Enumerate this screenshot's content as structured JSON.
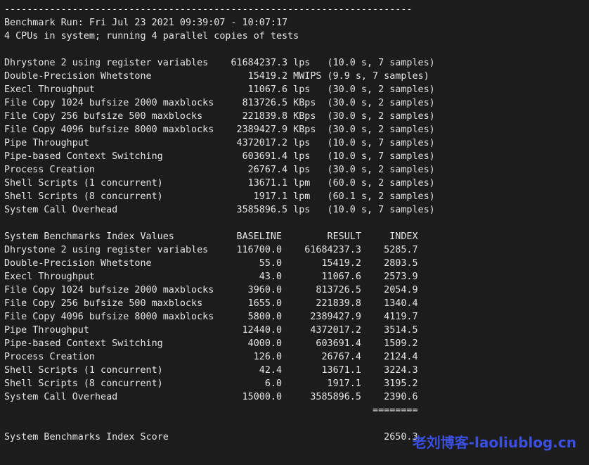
{
  "terminal": {
    "background_color": "#1c1c1c",
    "foreground_color": "#e4e4e4",
    "columns": 84,
    "rule": "------------------------------------------------------------------------",
    "header": {
      "run_line": "Benchmark Run: Fri Jul 23 2021 09:39:07 - 10:07:17",
      "cpu_line": "4 CPUs in system; running 4 parallel copies of tests"
    },
    "raw_results": {
      "rows": [
        {
          "name": "Dhrystone 2 using register variables",
          "value": "61684237.3",
          "unit": "lps",
          "timing": "(10.0 s, 7 samples)"
        },
        {
          "name": "Double-Precision Whetstone",
          "value": "15419.2",
          "unit": "MWIPS",
          "timing": "(9.9 s, 7 samples)"
        },
        {
          "name": "Execl Throughput",
          "value": "11067.6",
          "unit": "lps",
          "timing": "(30.0 s, 2 samples)"
        },
        {
          "name": "File Copy 1024 bufsize 2000 maxblocks",
          "value": "813726.5",
          "unit": "KBps",
          "timing": "(30.0 s, 2 samples)"
        },
        {
          "name": "File Copy 256 bufsize 500 maxblocks",
          "value": "221839.8",
          "unit": "KBps",
          "timing": "(30.0 s, 2 samples)"
        },
        {
          "name": "File Copy 4096 bufsize 8000 maxblocks",
          "value": "2389427.9",
          "unit": "KBps",
          "timing": "(30.0 s, 2 samples)"
        },
        {
          "name": "Pipe Throughput",
          "value": "4372017.2",
          "unit": "lps",
          "timing": "(10.0 s, 7 samples)"
        },
        {
          "name": "Pipe-based Context Switching",
          "value": "603691.4",
          "unit": "lps",
          "timing": "(10.0 s, 7 samples)"
        },
        {
          "name": "Process Creation",
          "value": "26767.4",
          "unit": "lps",
          "timing": "(30.0 s, 2 samples)"
        },
        {
          "name": "Shell Scripts (1 concurrent)",
          "value": "13671.1",
          "unit": "lpm",
          "timing": "(60.0 s, 2 samples)"
        },
        {
          "name": "Shell Scripts (8 concurrent)",
          "value": "1917.1",
          "unit": "lpm",
          "timing": "(60.1 s, 2 samples)"
        },
        {
          "name": "System Call Overhead",
          "value": "3585896.5",
          "unit": "lps",
          "timing": "(10.0 s, 7 samples)"
        }
      ]
    },
    "index_table": {
      "title": "System Benchmarks Index Values",
      "headers": [
        "BASELINE",
        "RESULT",
        "INDEX"
      ],
      "rows": [
        {
          "name": "Dhrystone 2 using register variables",
          "baseline": "116700.0",
          "result": "61684237.3",
          "index": "5285.7"
        },
        {
          "name": "Double-Precision Whetstone",
          "baseline": "55.0",
          "result": "15419.2",
          "index": "2803.5"
        },
        {
          "name": "Execl Throughput",
          "baseline": "43.0",
          "result": "11067.6",
          "index": "2573.9"
        },
        {
          "name": "File Copy 1024 bufsize 2000 maxblocks",
          "baseline": "3960.0",
          "result": "813726.5",
          "index": "2054.9"
        },
        {
          "name": "File Copy 256 bufsize 500 maxblocks",
          "baseline": "1655.0",
          "result": "221839.8",
          "index": "1340.4"
        },
        {
          "name": "File Copy 4096 bufsize 8000 maxblocks",
          "baseline": "5800.0",
          "result": "2389427.9",
          "index": "4119.7"
        },
        {
          "name": "Pipe Throughput",
          "baseline": "12440.0",
          "result": "4372017.2",
          "index": "3514.5"
        },
        {
          "name": "Pipe-based Context Switching",
          "baseline": "4000.0",
          "result": "603691.4",
          "index": "1509.2"
        },
        {
          "name": "Process Creation",
          "baseline": "126.0",
          "result": "26767.4",
          "index": "2124.4"
        },
        {
          "name": "Shell Scripts (1 concurrent)",
          "baseline": "42.4",
          "result": "13671.1",
          "index": "3224.3"
        },
        {
          "name": "Shell Scripts (8 concurrent)",
          "baseline": "6.0",
          "result": "1917.1",
          "index": "3195.2"
        },
        {
          "name": "System Call Overhead",
          "baseline": "15000.0",
          "result": "3585896.5",
          "index": "2390.6"
        }
      ],
      "separator": "========",
      "score_label": "System Benchmarks Index Score",
      "score_value": "2650.3"
    },
    "watermark": {
      "text": "老刘博客-laoliublog.cn",
      "color": "#3b4fe0"
    }
  }
}
